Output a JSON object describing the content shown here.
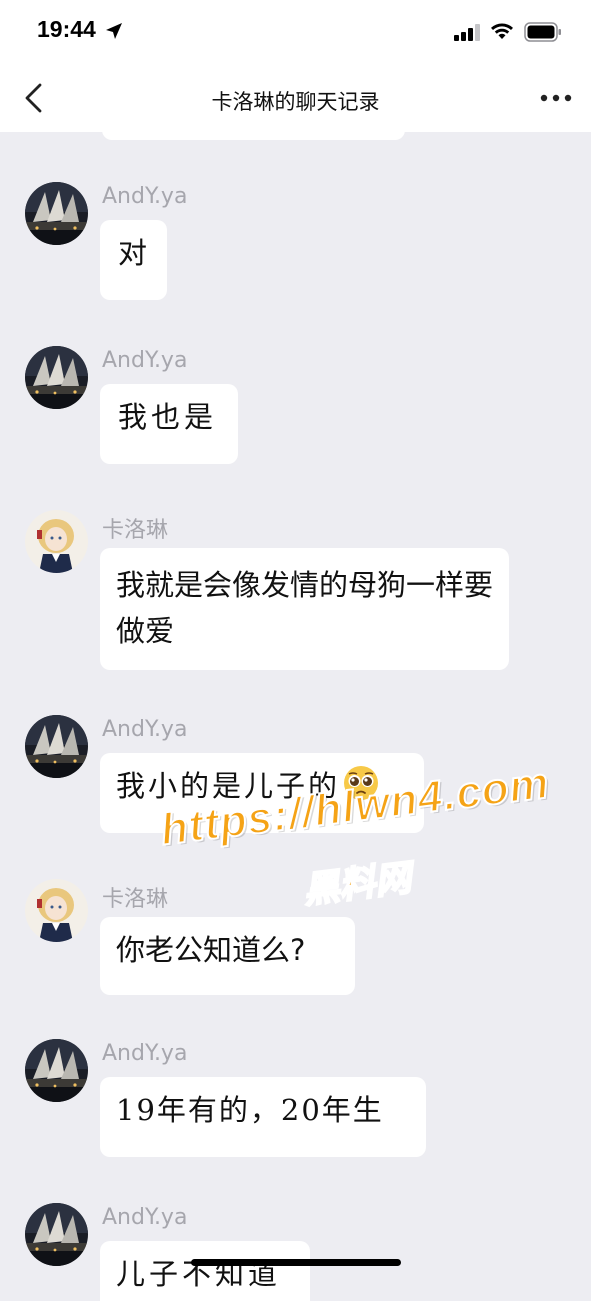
{
  "status_bar": {
    "time": "19:44",
    "icons": [
      "location-arrow-icon",
      "signal-icon",
      "wifi-icon",
      "battery-icon"
    ]
  },
  "nav": {
    "title": "卡洛琳的聊天记录",
    "back_icon": "chevron-left-icon",
    "more_icon": "more-dots-icon"
  },
  "colors": {
    "background": "#ededf2",
    "bubble": "#ffffff",
    "sender_name": "#a6a6ad",
    "watermark": "#f5a316"
  },
  "messages": [
    {
      "sender": "AndY.ya",
      "text": "对"
    },
    {
      "sender": "AndY.ya",
      "text": "我也是"
    },
    {
      "sender": "卡洛琳",
      "text": "我就是会像发情的母狗一样要做爱"
    },
    {
      "sender": "AndY.ya",
      "text": "我小的是儿子的",
      "emoji": "pleading-face-icon"
    },
    {
      "sender": "卡洛琳",
      "text": "你老公知道么?"
    },
    {
      "sender": "AndY.ya",
      "text": "19年有的，20年生"
    },
    {
      "sender": "AndY.ya",
      "text": "儿子不知道"
    }
  ],
  "watermark": {
    "url": "https://hlwn4.com",
    "name": "黑料网"
  }
}
